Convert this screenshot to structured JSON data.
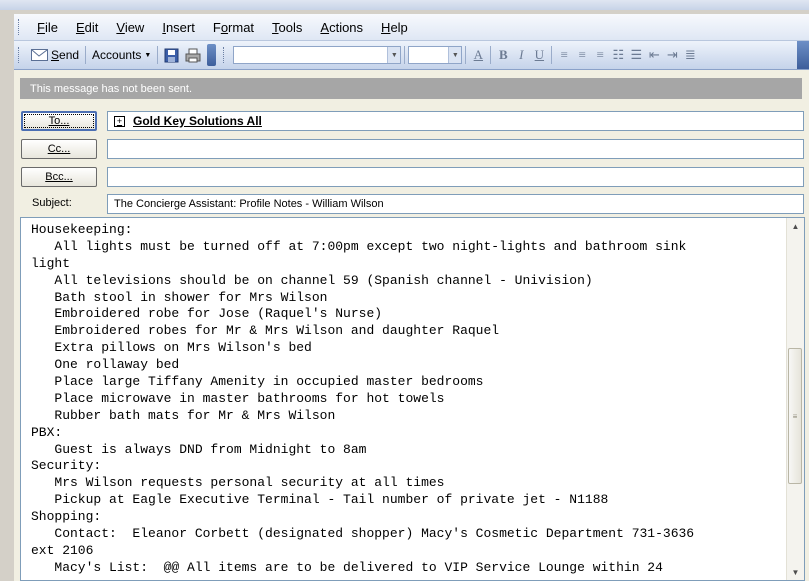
{
  "menu": [
    {
      "pre": "",
      "ul": "F",
      "post": "ile"
    },
    {
      "pre": "",
      "ul": "E",
      "post": "dit"
    },
    {
      "pre": "",
      "ul": "V",
      "post": "iew"
    },
    {
      "pre": "",
      "ul": "I",
      "post": "nsert"
    },
    {
      "pre": "F",
      "ul": "o",
      "post": "rmat"
    },
    {
      "pre": "",
      "ul": "T",
      "post": "ools"
    },
    {
      "pre": "",
      "ul": "A",
      "post": "ctions"
    },
    {
      "pre": "",
      "ul": "H",
      "post": "elp"
    }
  ],
  "toolbar": {
    "send_ul": "S",
    "send_rest": "end",
    "accounts": "Accounts"
  },
  "info_message": "This message has not been sent.",
  "buttons": {
    "to": "To...",
    "cc": "Cc...",
    "bcc": "Bcc..."
  },
  "to_recipient": "Gold Key Solutions All",
  "subject_label": "Subject:",
  "subject_value": "The Concierge Assistant:  Profile Notes - William Wilson",
  "body_lines": [
    "Housekeeping:",
    "   All lights must be turned off at 7:00pm except two night-lights and bathroom sink",
    "light",
    "   All televisions should be on channel 59 (Spanish channel - Univision)",
    "   Bath stool in shower for Mrs Wilson",
    "   Embroidered robe for Jose (Raquel's Nurse)",
    "   Embroidered robes for Mr & Mrs Wilson and daughter Raquel",
    "   Extra pillows on Mrs Wilson's bed",
    "   One rollaway bed",
    "   Place large Tiffany Amenity in occupied master bedrooms",
    "   Place microwave in master bathrooms for hot towels",
    "   Rubber bath mats for Mr & Mrs Wilson",
    "PBX:",
    "   Guest is always DND from Midnight to 8am",
    "Security:",
    "   Mrs Wilson requests personal security at all times",
    "   Pickup at Eagle Executive Terminal - Tail number of private jet - N1188",
    "Shopping:",
    "   Contact:  Eleanor Corbett (designated shopper) Macy's Cosmetic Department 731-3636",
    "ext 2106",
    "   Macy's List:  @@ All items are to be delivered to VIP Service Lounge within 24"
  ],
  "colors": {
    "infobar": "#a6a6a6",
    "toolbar_top": "#eef3fb",
    "toolbar_bottom": "#c5d3ea"
  },
  "icons": [
    "send-icon",
    "save-icon",
    "print-icon",
    "font-color-icon",
    "bold-icon",
    "italic-icon",
    "underline-icon",
    "align-left-icon",
    "align-center-icon",
    "align-right-icon",
    "numbering-icon",
    "bullets-icon",
    "decrease-indent-icon",
    "increase-indent-icon",
    "scroll-up-icon",
    "scroll-down-icon"
  ]
}
